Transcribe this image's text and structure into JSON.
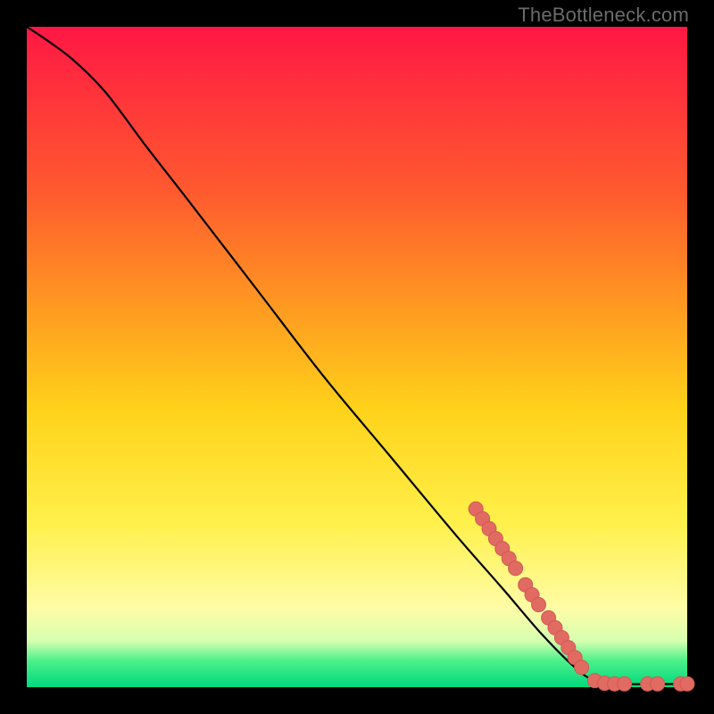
{
  "watermark": "TheBottleneck.com",
  "colors": {
    "gradient_top": "#ff1744",
    "gradient_mid_orange": "#ff9821",
    "gradient_mid_yellow": "#ffd21a",
    "gradient_pale": "#fffca6",
    "gradient_green": "#00d97e",
    "curve_stroke": "#000000",
    "marker_fill": "#e16b62",
    "marker_stroke": "#cf5a52",
    "frame": "#000000"
  },
  "chart_data": {
    "type": "line",
    "title": "",
    "xlabel": "",
    "ylabel": "",
    "xlim": [
      0,
      100
    ],
    "ylim": [
      0,
      100
    ],
    "grid": false,
    "legend": false,
    "note": "Axes are unlabeled; values below are pixel-normalized (0–100 each axis, y=0 at bottom). Curve starts top-left, gentle convex shoulder, then near-linear descent, then levels to y≈0 on the right.",
    "series": [
      {
        "name": "curve",
        "points": [
          {
            "x": 0,
            "y": 100
          },
          {
            "x": 3,
            "y": 98
          },
          {
            "x": 7,
            "y": 95
          },
          {
            "x": 12,
            "y": 90
          },
          {
            "x": 18,
            "y": 82
          },
          {
            "x": 25,
            "y": 73
          },
          {
            "x": 35,
            "y": 60
          },
          {
            "x": 45,
            "y": 47
          },
          {
            "x": 55,
            "y": 35
          },
          {
            "x": 65,
            "y": 23
          },
          {
            "x": 72,
            "y": 15
          },
          {
            "x": 78,
            "y": 8
          },
          {
            "x": 83,
            "y": 3
          },
          {
            "x": 86,
            "y": 1
          },
          {
            "x": 90,
            "y": 0.5
          },
          {
            "x": 100,
            "y": 0.5
          }
        ]
      }
    ],
    "markers": [
      {
        "x": 68,
        "y": 27
      },
      {
        "x": 69,
        "y": 25.5
      },
      {
        "x": 70,
        "y": 24
      },
      {
        "x": 71,
        "y": 22.5
      },
      {
        "x": 72,
        "y": 21
      },
      {
        "x": 73,
        "y": 19.5
      },
      {
        "x": 74,
        "y": 18
      },
      {
        "x": 75.5,
        "y": 15.5
      },
      {
        "x": 76.5,
        "y": 14
      },
      {
        "x": 77.5,
        "y": 12.5
      },
      {
        "x": 79,
        "y": 10.5
      },
      {
        "x": 80,
        "y": 9
      },
      {
        "x": 81,
        "y": 7.5
      },
      {
        "x": 82,
        "y": 6
      },
      {
        "x": 83,
        "y": 4.5
      },
      {
        "x": 84,
        "y": 3
      },
      {
        "x": 86,
        "y": 1
      },
      {
        "x": 87.5,
        "y": 0.6
      },
      {
        "x": 89,
        "y": 0.5
      },
      {
        "x": 90.5,
        "y": 0.5
      },
      {
        "x": 94,
        "y": 0.5
      },
      {
        "x": 95.5,
        "y": 0.5
      },
      {
        "x": 99,
        "y": 0.5
      },
      {
        "x": 100,
        "y": 0.5
      }
    ]
  }
}
